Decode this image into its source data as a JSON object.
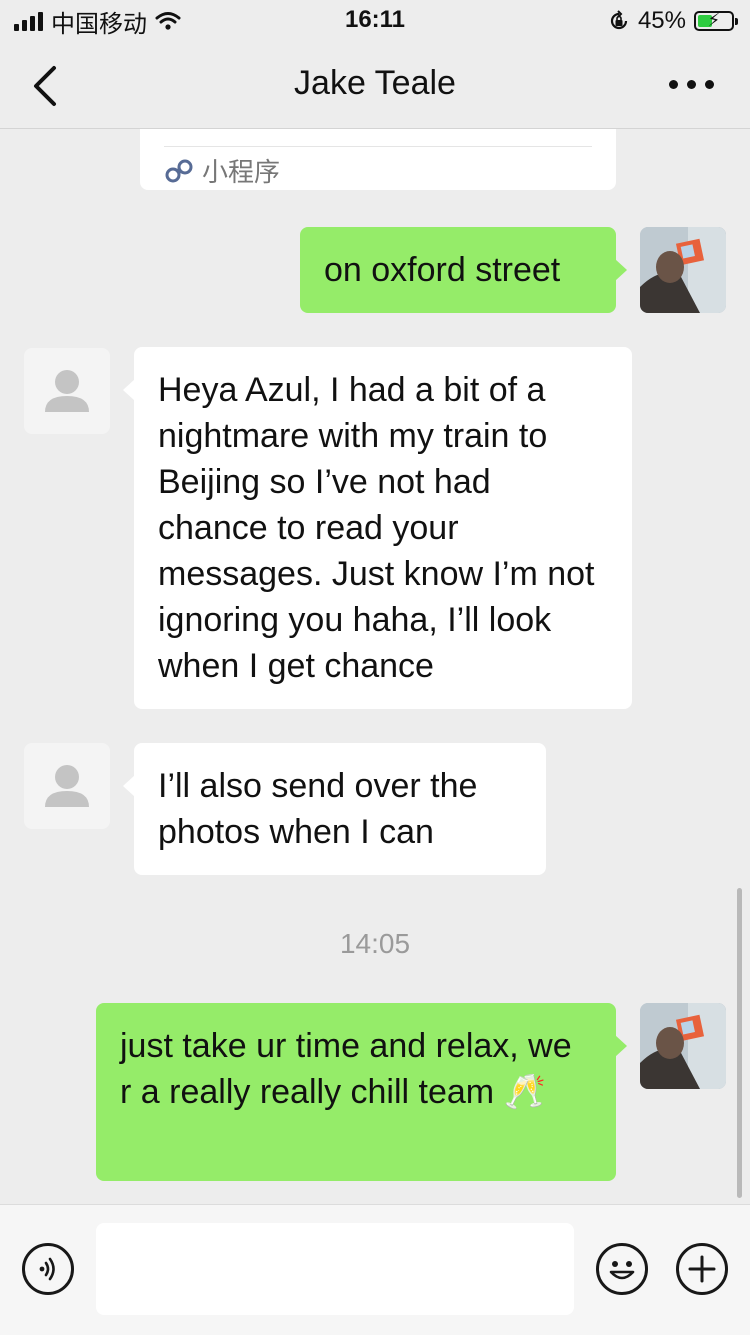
{
  "status_bar": {
    "carrier": "中国移动",
    "time": "16:11",
    "battery_percent": "45%",
    "battery_level": 0.45
  },
  "nav": {
    "title": "Jake Teale",
    "back_icon": "chevron-left-icon",
    "more_icon": "more-dots-icon"
  },
  "mini_program_card": {
    "label": "小程序",
    "icon": "mini-program-link-icon"
  },
  "messages": [
    {
      "direction": "outgoing",
      "text": "on oxford street"
    },
    {
      "direction": "incoming",
      "text": "Heya Azul, I had a bit of a nightmare with my train to Beijing so I’ve not had chance to read your messages. Just know I’m not ignoring you haha, I’ll look when I get chance"
    },
    {
      "direction": "incoming",
      "text": "I’ll also send over the photos when I can"
    },
    {
      "direction": "outgoing",
      "text": "just take ur time and relax, we r a really really chill team 🥂"
    }
  ],
  "timestamp": "14:05",
  "input_bar": {
    "voice_icon": "voice-icon",
    "text_value": "",
    "emoji_icon": "emoji-icon",
    "plus_icon": "plus-icon"
  },
  "colors": {
    "background": "#ededed",
    "outgoing_bubble": "#95ec69",
    "incoming_bubble": "#ffffff"
  }
}
